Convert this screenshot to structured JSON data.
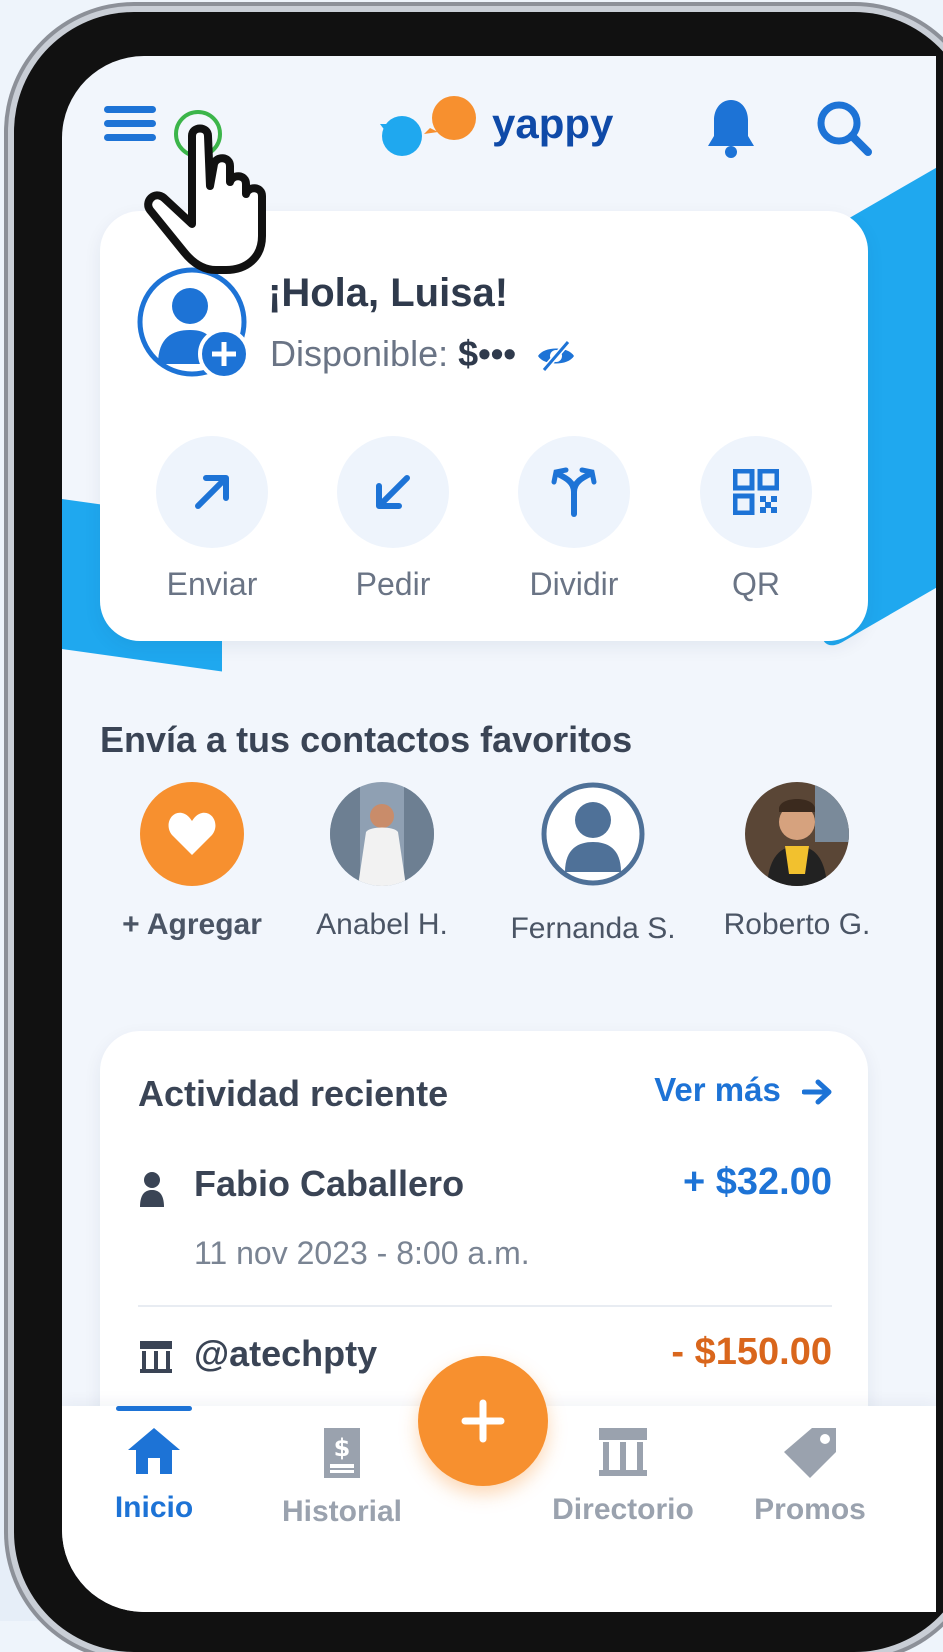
{
  "header": {
    "brand": "yappy",
    "menu_icon": "hamburger-menu-icon",
    "notifications_icon": "bell-icon",
    "search_icon": "search-icon"
  },
  "greeting_card": {
    "greeting": "¡Hola, Luisa!",
    "balance_label": "Disponible:",
    "balance_value": "$•••",
    "actions": [
      {
        "label": "Enviar",
        "icon": "arrow-up-right-icon"
      },
      {
        "label": "Pedir",
        "icon": "arrow-down-left-icon"
      },
      {
        "label": "Dividir",
        "icon": "split-icon"
      },
      {
        "label": "QR",
        "icon": "qr-code-icon"
      }
    ]
  },
  "favorites": {
    "title": "Envía a tus contactos favoritos",
    "add_label": "+ Agregar",
    "contacts": [
      {
        "name": "Anabel H."
      },
      {
        "name": "Fernanda S."
      },
      {
        "name": "Roberto G."
      }
    ]
  },
  "activity": {
    "title": "Actividad reciente",
    "see_more": "Ver más",
    "items": [
      {
        "name": "Fabio Caballero",
        "amount": "+ $32.00",
        "date": "11 nov 2023 - 8:00 a.m.",
        "icon": "person-icon"
      },
      {
        "name": "@atechpty",
        "amount": "- $150.00",
        "icon": "store-icon"
      }
    ]
  },
  "bottom_nav": {
    "items": [
      {
        "label": "Inicio",
        "icon": "home-icon",
        "active": true
      },
      {
        "label": "Historial",
        "icon": "receipt-icon",
        "active": false
      },
      {
        "label": "Directorio",
        "icon": "store-icon",
        "active": false
      },
      {
        "label": "Promos",
        "icon": "tag-icon",
        "active": false
      }
    ]
  },
  "colors": {
    "primary": "#1d73d6",
    "accent": "#f7902f",
    "positive": "#1d73d6",
    "negative": "#d9661c",
    "background": "#f2f6fc"
  }
}
